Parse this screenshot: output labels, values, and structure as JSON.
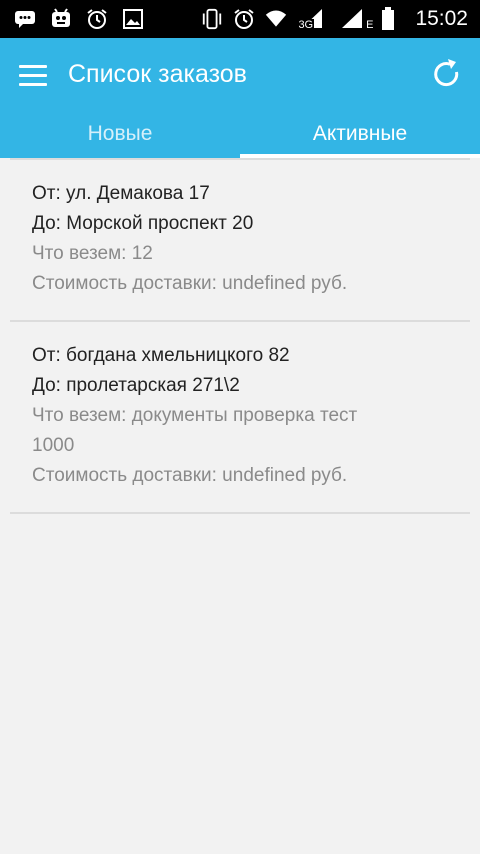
{
  "status_bar": {
    "time": "15:02",
    "network_label": "3G",
    "network_label_2": "E",
    "icons": [
      "message-icon",
      "robot-icon",
      "alarm-icon",
      "image-icon",
      "vibrate-icon",
      "alarm-icon",
      "wifi-icon",
      "signal-icon",
      "signal-icon",
      "battery-icon"
    ]
  },
  "header": {
    "title": "Список заказов",
    "bg_color": "#33b5e5",
    "tabs": [
      {
        "label": "Новые",
        "active": false
      },
      {
        "label": "Активные",
        "active": true
      }
    ]
  },
  "orders": [
    {
      "from": "От: ул. Демакова 17",
      "to": "До: Морской проспект 20",
      "cargo": "Что везем: 12",
      "price": "Стоимость доставки: undefined руб."
    },
    {
      "from": "От: богдана хмельницкого 82",
      "to": "До: пролетарская 271\\2",
      "cargo": "Что везем: документы проверка тест 1000",
      "price": "Стоимость доставки: undefined руб."
    }
  ],
  "colors": {
    "accent": "#33b5e5",
    "tab_active_text": "#ffffff",
    "tab_inactive_text": "#d6f0fa",
    "tab_indicator": "#ffffff",
    "background": "#f2f2f2"
  }
}
